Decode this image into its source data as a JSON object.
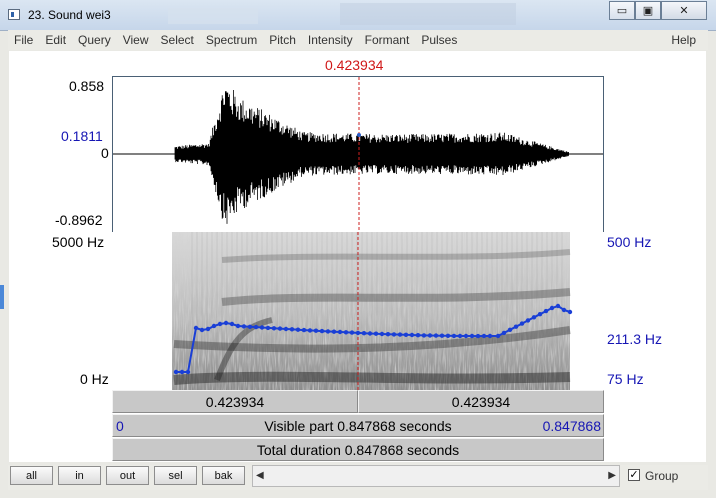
{
  "window": {
    "title": "23. Sound wei3",
    "minimize_glyph": "▭",
    "maximize_glyph": "▣",
    "close_glyph": "✕"
  },
  "menu": {
    "items": [
      "File",
      "Edit",
      "Query",
      "View",
      "Select",
      "Spectrum",
      "Pitch",
      "Intensity",
      "Formant",
      "Pulses"
    ],
    "help": "Help"
  },
  "editor": {
    "cursor_time": "0.423934",
    "waveform": {
      "y_max": "0.858",
      "y_cursor": "0.1811",
      "y_zero": "0",
      "y_min": "-0.8962"
    },
    "spectrogram": {
      "freq_max": "5000 Hz",
      "freq_min": "0 Hz"
    },
    "pitch": {
      "max": "500 Hz",
      "cursor_value": "211.3 Hz",
      "min": "75 Hz"
    },
    "segments": {
      "left": "0.423934",
      "right": "0.423934"
    },
    "visible": {
      "start": "0",
      "label": "Visible part 0.847868 seconds",
      "end": "0.847868"
    },
    "total": {
      "label": "Total duration 0.847868 seconds"
    }
  },
  "bottom": {
    "buttons": [
      "all",
      "in",
      "out",
      "sel",
      "bak"
    ],
    "scroll_left": "◀",
    "scroll_right": "▶",
    "group_label": "Group",
    "group_checked": "✓"
  },
  "colors": {
    "pitch": "#1a3fd6",
    "cursor": "#cc1f1f",
    "text_blue": "#1616b4",
    "panel": "#c8c8c8"
  }
}
